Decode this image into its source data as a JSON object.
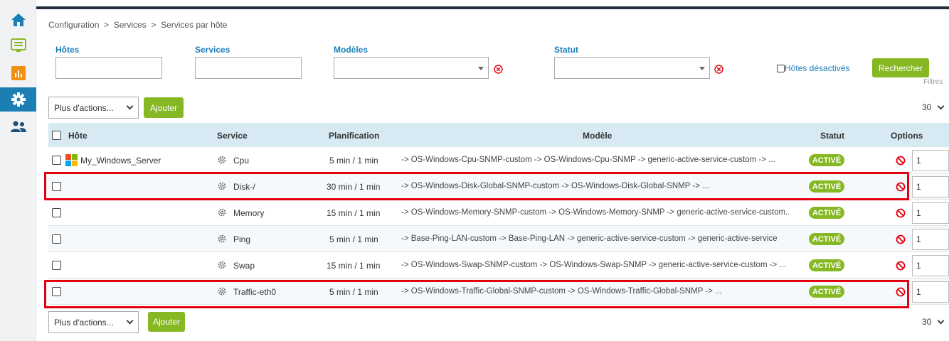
{
  "breadcrumb": "Configuration  >  Services  >  Services par hôte",
  "filters": {
    "hosts_label": "Hôtes",
    "services_label": "Services",
    "models_label": "Modèles",
    "status_label": "Statut",
    "disabled_hosts_label": "Hôtes désactivés",
    "search_button": "Rechercher",
    "filters_link": "Filtres"
  },
  "actions_top": {
    "select_label": "Plus d'actions...",
    "add_label": "Ajouter",
    "page_size": "30"
  },
  "actions_bottom": {
    "select_label": "Plus d'actions...",
    "add_label": "Ajouter",
    "page_size": "30"
  },
  "table": {
    "headers": {
      "host": "Hôte",
      "service": "Service",
      "schedule": "Planification",
      "template": "Modèle",
      "status": "Statut",
      "options": "Options"
    },
    "rows": [
      {
        "host": "My_Windows_Server",
        "service": "Cpu",
        "schedule": "5 min / 1 min",
        "template": "-> OS-Windows-Cpu-SNMP-custom -> OS-Windows-Cpu-SNMP -> generic-active-service-custom -> ...",
        "status": "ACTIVÉ",
        "options_value": "1"
      },
      {
        "host": "",
        "service": "Disk-/",
        "schedule": "30 min / 1 min",
        "template": "-> OS-Windows-Disk-Global-SNMP-custom -> OS-Windows-Disk-Global-SNMP -> ...",
        "status": "ACTIVÉ",
        "options_value": "1"
      },
      {
        "host": "",
        "service": "Memory",
        "schedule": "15 min / 1 min",
        "template": "-> OS-Windows-Memory-SNMP-custom -> OS-Windows-Memory-SNMP -> generic-active-service-custom...",
        "status": "ACTIVÉ",
        "options_value": "1"
      },
      {
        "host": "",
        "service": "Ping",
        "schedule": "5 min / 1 min",
        "template": "-> Base-Ping-LAN-custom -> Base-Ping-LAN -> generic-active-service-custom -> generic-active-service",
        "status": "ACTIVÉ",
        "options_value": "1"
      },
      {
        "host": "",
        "service": "Swap",
        "schedule": "15 min / 1 min",
        "template": "-> OS-Windows-Swap-SNMP-custom -> OS-Windows-Swap-SNMP -> generic-active-service-custom -> ...",
        "status": "ACTIVÉ",
        "options_value": "1"
      },
      {
        "host": "",
        "service": "Traffic-eth0",
        "schedule": "5 min / 1 min",
        "template": "-> OS-Windows-Traffic-Global-SNMP-custom -> OS-Windows-Traffic-Global-SNMP -> ...",
        "status": "ACTIVÉ",
        "options_value": "1"
      }
    ]
  },
  "colors": {
    "accent": "#1b7fbb",
    "active_green": "#86b823",
    "highlight_red": "#e3000f",
    "header_bg": "#d7e9f3"
  },
  "sidebar_icons": [
    "home-icon",
    "monitoring-icon",
    "reporting-icon",
    "configuration-icon",
    "administration-icon"
  ]
}
